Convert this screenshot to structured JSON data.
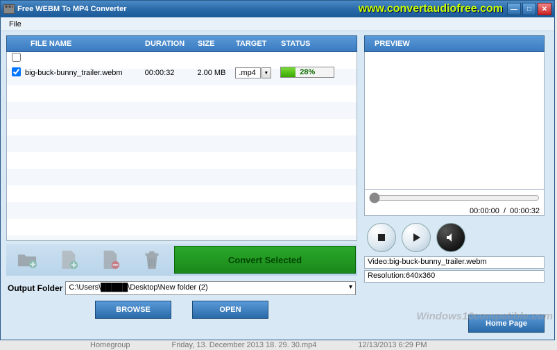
{
  "window": {
    "title": "Free WEBM To MP4 Converter",
    "url": "www.convertaudiofree.com"
  },
  "menu": {
    "file": "File"
  },
  "table": {
    "headers": {
      "name": "FILE NAME",
      "dur": "DURATION",
      "size": "SIZE",
      "tgt": "TARGET",
      "stat": "STATUS"
    },
    "rows": [
      {
        "checked": true,
        "name": "big-buck-bunny_trailer.webm",
        "dur": "00:00:32",
        "size": "2.00 MB",
        "target": ".mp4",
        "progress_pct": 28,
        "progress_txt": "28%"
      }
    ]
  },
  "toolbar": {
    "convert": "Convert Selected"
  },
  "output": {
    "label": "Output Folder",
    "path": "C:\\Users\\█████\\Desktop\\New folder (2)",
    "browse": "BROWSE",
    "open": "OPEN"
  },
  "preview": {
    "header": "PREVIEW",
    "time_current": "00:00:00",
    "time_sep": "/",
    "time_total": "00:00:32",
    "video_label": "Video:big-buck-bunny_trailer.webm",
    "res_label": "Resolution:640x360"
  },
  "home": "Home Page",
  "watermark": "Windows10compatible.com",
  "taskbar": {
    "a": "Homegroup",
    "b": "Friday, 13. December 2013 18. 29. 30.mp4",
    "c": "12/13/2013 6:29 PM"
  }
}
